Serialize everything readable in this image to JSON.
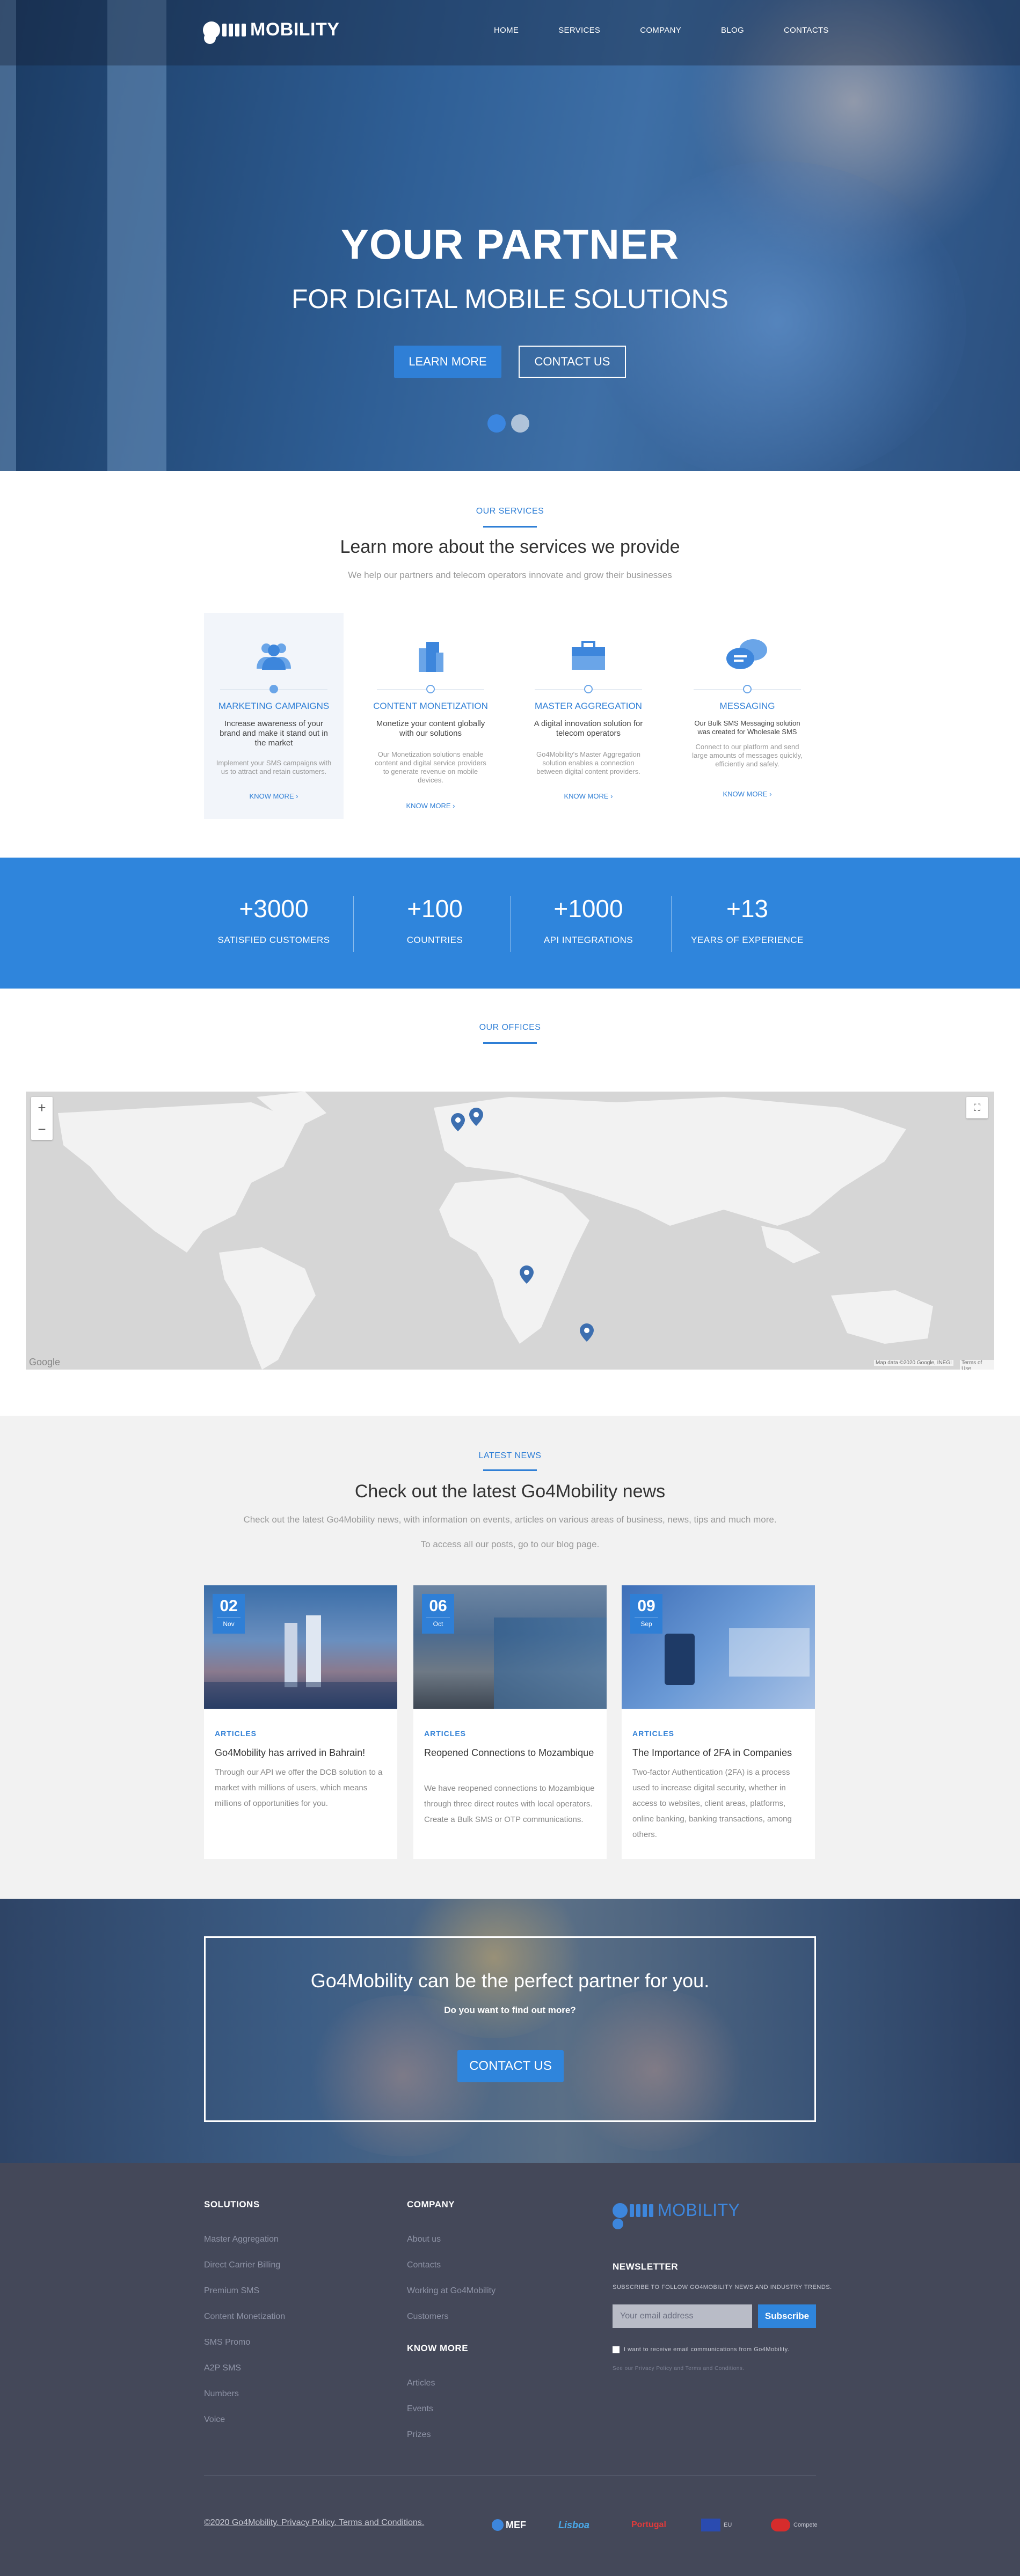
{
  "colors": {
    "accent": "#2f7fd6",
    "footer_bg": "#444859",
    "stats_bg": "#2f85dc",
    "news_bg": "#f2f2f2"
  },
  "header": {
    "logo_text": "MOBILITY",
    "nav": [
      "HOME",
      "SERVICES",
      "COMPANY",
      "BLOG",
      "CONTACTS"
    ]
  },
  "hero": {
    "title": "YOUR PARTNER",
    "subtitle": "FOR DIGITAL MOBILE SOLUTIONS",
    "learn_more": "LEARN MORE",
    "contact_us": "CONTACT US",
    "slides": 2,
    "active_slide": 1
  },
  "services": {
    "tag": "OUR SERVICES",
    "title": "Learn more about the services we provide",
    "subtitle": "We help our partners and telecom operators innovate and grow their businesses",
    "items": [
      {
        "icon": "people-icon",
        "title": "MARKETING CAMPAIGNS",
        "desc": "Increase awareness of your brand and make it stand out in the market",
        "detail": "Implement your SMS campaigns with us to attract and retain customers.",
        "link": "KNOW MORE ›"
      },
      {
        "icon": "building-icon",
        "title": "CONTENT MONETIZATION",
        "desc": "Monetize your content globally with our solutions",
        "detail": "Our Monetization solutions enable content and digital service providers to generate revenue on mobile devices.",
        "link": "KNOW MORE ›"
      },
      {
        "icon": "briefcase-icon",
        "title": "MASTER AGGREGATION",
        "desc": "A digital innovation solution for telecom operators",
        "detail": "Go4Mobility's Master Aggregation solution enables a connection between digital content providers.",
        "link": "KNOW MORE ›"
      },
      {
        "icon": "chat-bubbles-icon",
        "title": "MESSAGING",
        "desc": "Our Bulk SMS Messaging solution was created for Wholesale SMS",
        "detail": "Connect to our platform and send large amounts of messages quickly, efficiently and safely.",
        "link": "KNOW MORE ›"
      }
    ]
  },
  "stats": [
    {
      "value": "+3000",
      "label": "SATISFIED CUSTOMERS"
    },
    {
      "value": "+100",
      "label": "COUNTRIES"
    },
    {
      "value": "+1000",
      "label": "API INTEGRATIONS"
    },
    {
      "value": "+13",
      "label": "YEARS OF EXPERIENCE"
    }
  ],
  "offices": {
    "tag": "OUR OFFICES",
    "map_brand": "Google",
    "map_attribution": "Map data ©2020 Google, INEGI",
    "map_terms": "Terms of Use"
  },
  "news": {
    "tag": "LATEST NEWS",
    "title": "Check out the latest Go4Mobility news",
    "subtitle": "Check out the latest Go4Mobility news, with information on events, articles on various areas of business, news, tips and much more.",
    "subtitle2": "To access all our posts, go to our blog page.",
    "cards": [
      {
        "day": "02",
        "month": "Nov",
        "category": "ARTICLES",
        "title": "Go4Mobility has arrived in Bahrain!",
        "excerpt": "Through our API we offer the DCB solution to a market with millions of users, which means millions of opportunities for you."
      },
      {
        "day": "06",
        "month": "Oct",
        "category": "ARTICLES",
        "title": "Reopened Connections to Mozambique",
        "excerpt": "We have reopened connections to Mozambique through three direct routes with local operators. Create a Bulk SMS or OTP communications."
      },
      {
        "day": "09",
        "month": "Sep",
        "category": "ARTICLES",
        "title": "The Importance of 2FA in Companies",
        "excerpt": "Two-factor Authentication (2FA) is a process used to increase digital security, whether in access to websites, client areas, platforms, online banking, banking transactions, among others."
      }
    ]
  },
  "cta": {
    "title": "Go4Mobility can be the perfect partner for you.",
    "subtitle": "Do you want to find out more?",
    "button": "CONTACT US"
  },
  "footer": {
    "solutions_title": "SOLUTIONS",
    "solutions": [
      "Master Aggregation",
      "Direct Carrier Billing",
      "Premium SMS",
      "Content Monetization",
      "SMS Promo",
      "A2P SMS",
      "Numbers",
      "Voice"
    ],
    "company_title": "COMPANY",
    "company": [
      "About us",
      "Contacts",
      "Working at Go4Mobility",
      "Customers"
    ],
    "know_more_title": "KNOW MORE",
    "know_more": [
      "Articles",
      "Events",
      "Prizes"
    ],
    "logo_text": "MOBILITY",
    "newsletter_title": "NEWSLETTER",
    "newsletter_sub": "SUBSCRIBE TO FOLLOW GO4MOBILITY NEWS AND INDUSTRY TRENDS.",
    "email_placeholder": "Your email address",
    "subscribe": "Subscribe",
    "consent": "I want to receive email communications from Go4Mobility.",
    "privacy_note": "See our Privacy Policy and Terms and Conditions.",
    "copyright": "©2020 Go4Mobility. Privacy Policy. Terms and Conditions.",
    "partners": [
      "MEF",
      "Lisboa",
      "Portugal",
      "EU",
      "Compete"
    ]
  }
}
